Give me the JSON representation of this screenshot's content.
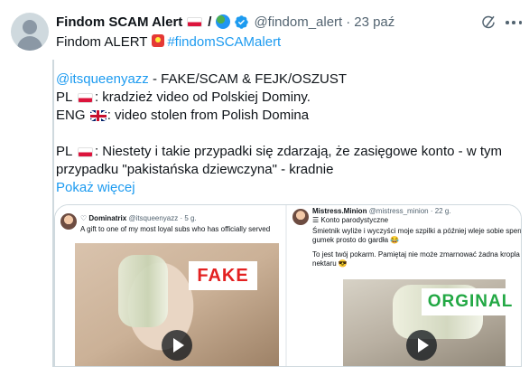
{
  "tweet": {
    "author_name": "Findom SCAM Alert",
    "separator": "/",
    "handle": "@findom_alert",
    "dot": "·",
    "date": "23 paź",
    "alert_prefix": "Findom ALERT",
    "alert_hashtag": "#findomSCAMalert",
    "mention": "@itsqueenyazz",
    "line1_rest": " - FAKE/SCAM & FEJK/OSZUST",
    "line2_prefix": "PL",
    "line2_rest": ": kradzież video od Polskiej Dominy.",
    "line3_prefix": "ENG",
    "line3_rest": ": video stolen from Polish Domina",
    "line4_prefix": "PL",
    "line4_rest": ": Niestety i takie przypadki się zdarzają, że zasięgowe konto - w tym",
    "line5": "przypadku \"pakistańska dziewczyna\" - kradnie",
    "show_more": "Pokaż więcej"
  },
  "media": {
    "left": {
      "name": "Dominatrix",
      "handle": "@itsqueenyazz",
      "age": "· 5 g.",
      "caption": "A gift to one of my most loyal subs who has officially served",
      "label": "FAKE"
    },
    "right": {
      "name": "Mistress.Minion",
      "handle": "@mistress_minion",
      "age": "· 22 g.",
      "badge": "Konto parodystyczne",
      "caption_1": "Śmietnik wyliże i wyczyści moje szpilki a później wleje sobie spermę z",
      "caption_2": "gumek prosto do gardła 😂",
      "caption_3": "To jest twój pokarm. Pamiętaj nie może zmarnować żadna kropla tego",
      "caption_4": "nektaru 😎",
      "label": "ORGINAL"
    }
  },
  "colors": {
    "link": "#1d9bf0",
    "muted": "#536471",
    "fake": "#e32121",
    "orginal": "#22a844"
  },
  "icons": [
    "avatar-default-icon",
    "poland-flag-icon",
    "globe-icon",
    "verified-badge-icon",
    "grok-icon",
    "more-icon",
    "rotating-light-icon",
    "uk-flag-icon",
    "play-icon"
  ]
}
